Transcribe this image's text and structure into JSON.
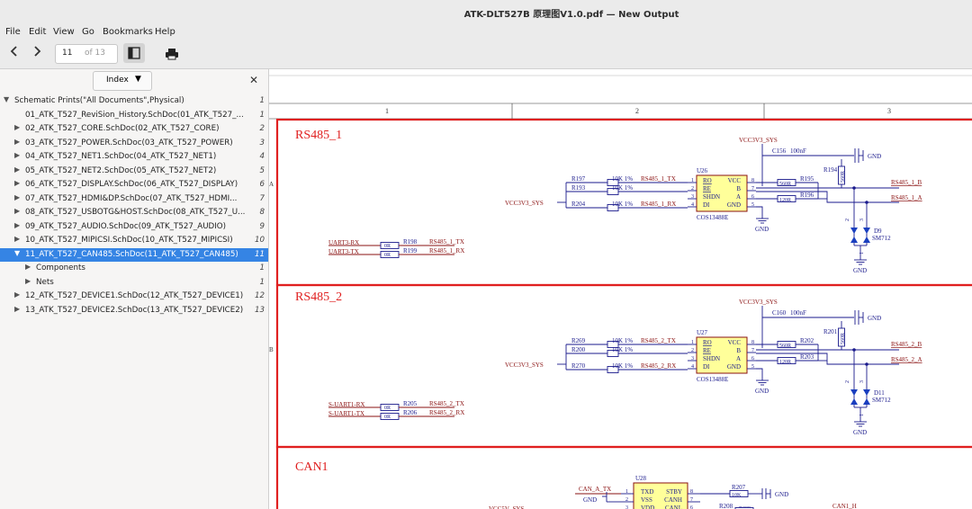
{
  "window": {
    "title": "ATK-DLT527B 原理图V1.0.pdf — New Output"
  },
  "menu": [
    "File",
    "Edit",
    "View",
    "Go",
    "Bookmarks",
    "Help"
  ],
  "toolbar": {
    "page_current": "11",
    "page_total": "of 13"
  },
  "sidebar": {
    "index_label": "Index",
    "items": [
      {
        "label": "Schematic Prints(\"All Documents\",Physical)",
        "page": "1",
        "level": 0,
        "toggle": "open"
      },
      {
        "label": "01_ATK_T527_ReviSion_History.SchDoc(01_ATK_T527_...",
        "page": "1",
        "level": 1,
        "toggle": "none"
      },
      {
        "label": "02_ATK_T527_CORE.SchDoc(02_ATK_T527_CORE)",
        "page": "2",
        "level": 1,
        "toggle": "closed"
      },
      {
        "label": "03_ATK_T527_POWER.SchDoc(03_ATK_T527_POWER)",
        "page": "3",
        "level": 1,
        "toggle": "closed"
      },
      {
        "label": "04_ATK_T527_NET1.SchDoc(04_ATK_T527_NET1)",
        "page": "4",
        "level": 1,
        "toggle": "closed"
      },
      {
        "label": "05_ATK_T527_NET2.SchDoc(05_ATK_T527_NET2)",
        "page": "5",
        "level": 1,
        "toggle": "closed"
      },
      {
        "label": "06_ATK_T527_DISPLAY.SchDoc(06_ATK_T527_DISPLAY)",
        "page": "6",
        "level": 1,
        "toggle": "closed"
      },
      {
        "label": "07_ATK_T527_HDMI&DP.SchDoc(07_ATK_T527_HDMI...",
        "page": "7",
        "level": 1,
        "toggle": "closed"
      },
      {
        "label": "08_ATK_T527_USBOTG&HOST.SchDoc(08_ATK_T527_U...",
        "page": "8",
        "level": 1,
        "toggle": "closed"
      },
      {
        "label": "09_ATK_T527_AUDIO.SchDoc(09_ATK_T527_AUDIO)",
        "page": "9",
        "level": 1,
        "toggle": "closed"
      },
      {
        "label": "10_ATK_T527_MIPICSI.SchDoc(10_ATK_T527_MIPICSI)",
        "page": "10",
        "level": 1,
        "toggle": "closed"
      },
      {
        "label": "11_ATK_T527_CAN485.SchDoc(11_ATK_T527_CAN485)",
        "page": "11",
        "level": 1,
        "toggle": "open",
        "selected": true
      },
      {
        "label": "Components",
        "page": "1",
        "level": 2,
        "toggle": "closed"
      },
      {
        "label": "Nets",
        "page": "1",
        "level": 2,
        "toggle": "closed"
      },
      {
        "label": "12_ATK_T527_DEVICE1.SchDoc(12_ATK_T527_DEVICE1)",
        "page": "12",
        "level": 1,
        "toggle": "closed"
      },
      {
        "label": "13_ATK_T527_DEVICE2.SchDoc(13_ATK_T527_DEVICE2)",
        "page": "13",
        "level": 1,
        "toggle": "closed"
      }
    ]
  },
  "schematic": {
    "columns": [
      "1",
      "2",
      "3"
    ],
    "side_marks": [
      "A",
      "B"
    ],
    "sections": [
      {
        "title": "RS485_1",
        "power": "VCC3V3_SYS",
        "cap": "C156",
        "cap_value": "100nF",
        "gnd": "GND",
        "in_net": "VCC3V3_SYS",
        "chip": "U26",
        "chip_part": "COS13488E",
        "pins_left": [
          "RO",
          "RE",
          "SHDN",
          "DI"
        ],
        "pins_right": [
          "VCC",
          "B",
          "A",
          "GND"
        ],
        "pinnums_left": [
          "1",
          "2",
          "3",
          "4"
        ],
        "pinnums_right": [
          "8",
          "7",
          "6",
          "5"
        ],
        "resistors_left": [
          {
            "ref": "R197",
            "val": "10K 1%",
            "net": "RS485_1_TX"
          },
          {
            "ref": "R193",
            "val": "10K 1%",
            "net": ""
          },
          {
            "ref": "R204",
            "val": "10K 1%",
            "net": "RS485_1_RX"
          }
        ],
        "resistors_right": [
          {
            "ref": "R195",
            "val": "560R"
          },
          {
            "ref": "R196",
            "val": "120R"
          },
          {
            "ref": "R194",
            "val": "560R"
          }
        ],
        "out_nets": [
          "RS485_1_B",
          "RS485_1_A"
        ],
        "tvs": "D9",
        "tvs_part": "SM712",
        "tvs_pins": [
          "2",
          "3",
          "1"
        ],
        "uart": [
          {
            "net": "UART3-RX",
            "val": "0R",
            "ref": "R198",
            "sig": "RS485_1_TX"
          },
          {
            "net": "UART3-TX",
            "val": "0R",
            "ref": "R199",
            "sig": "RS485_1_RX"
          }
        ]
      },
      {
        "title": "RS485_2",
        "power": "VCC3V3_SYS",
        "cap": "C160",
        "cap_value": "100nF",
        "gnd": "GND",
        "in_net": "VCC3V3_SYS",
        "chip": "U27",
        "chip_part": "COS13488E",
        "pins_left": [
          "RO",
          "RE",
          "SHDN",
          "DI"
        ],
        "pins_right": [
          "VCC",
          "B",
          "A",
          "GND"
        ],
        "pinnums_left": [
          "1",
          "2",
          "3",
          "4"
        ],
        "pinnums_right": [
          "8",
          "7",
          "6",
          "5"
        ],
        "resistors_left": [
          {
            "ref": "R269",
            "val": "10K 1%",
            "net": "RS485_2_TX"
          },
          {
            "ref": "R200",
            "val": "10K 1%",
            "net": ""
          },
          {
            "ref": "R270",
            "val": "10K 1%",
            "net": "RS485_2_RX"
          }
        ],
        "resistors_right": [
          {
            "ref": "R202",
            "val": "560R"
          },
          {
            "ref": "R203",
            "val": "120R"
          },
          {
            "ref": "R201",
            "val": "560R"
          }
        ],
        "out_nets": [
          "RS485_2_B",
          "RS485_2_A"
        ],
        "tvs": "D11",
        "tvs_part": "SM712",
        "tvs_pins": [
          "2",
          "3",
          "1"
        ],
        "uart": [
          {
            "net": "S-UART1-RX",
            "val": "0R",
            "ref": "R205",
            "sig": "RS485_2_TX"
          },
          {
            "net": "S-UART1-TX",
            "val": "0R",
            "ref": "R206",
            "sig": "RS485_2_RX"
          }
        ]
      }
    ],
    "can": {
      "title": "CAN1",
      "chip": "U28",
      "pins_left": [
        "TXD",
        "VSS",
        "VDD"
      ],
      "pins_right": [
        "STBY",
        "CANH",
        "CANL"
      ],
      "pinnums_left": [
        "1",
        "2",
        "3"
      ],
      "pinnums_right": [
        "8",
        "7",
        "6"
      ],
      "net_tx": "CAN_A_TX",
      "gnd": "GND",
      "power": "VCC5V_SYS",
      "r207": "R207",
      "r207_val": "10K",
      "r208": "R208",
      "r209": "R209",
      "out_net": "CAN1_H"
    }
  }
}
